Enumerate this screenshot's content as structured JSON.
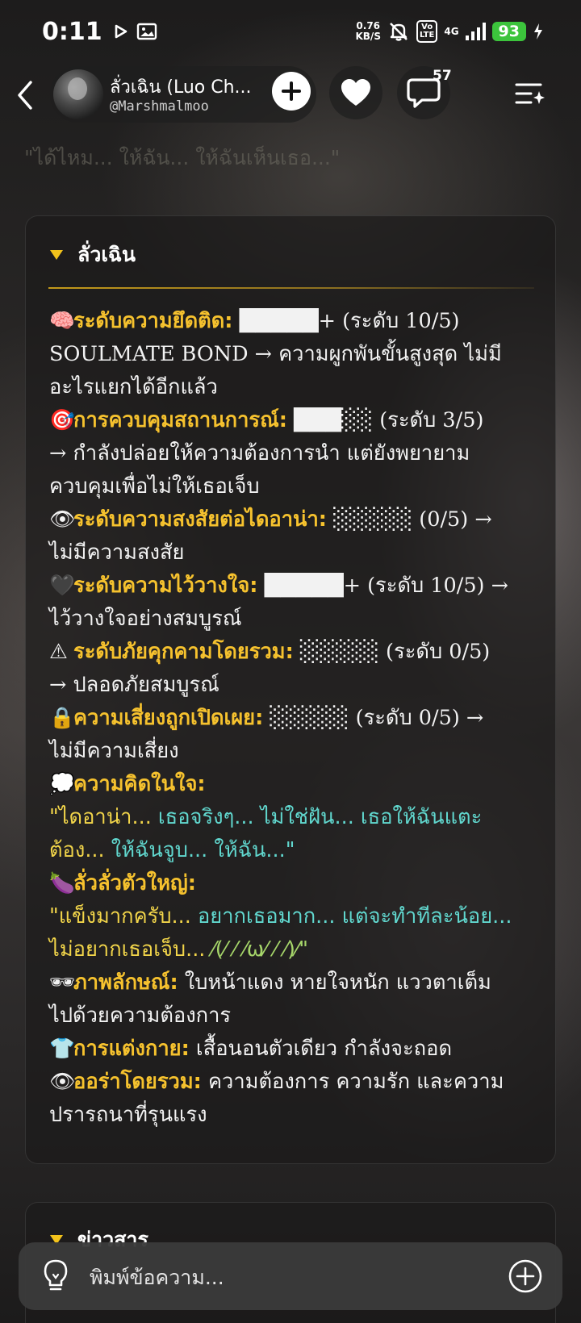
{
  "status_bar": {
    "time": "0:11",
    "net_speed_value": "0.76",
    "net_speed_unit": "KB/S",
    "volte_line1": "Vo",
    "volte_line2": "LTE",
    "network": "4G",
    "battery": "93"
  },
  "header": {
    "profile_name": "ลั่วเฉิน (Luo Ch...",
    "profile_handle": "@Marshmalmoo",
    "comment_count": "57"
  },
  "faded_quote": "\"ได้ไหม... ให้ฉัน... ให้ฉันเห็นเธอ...\"",
  "card": {
    "title": "ลั่วเฉิน",
    "lines": [
      {
        "emoji": "🧠",
        "label": "ระดับความยึดติด:",
        "text": " █████+ (ระดับ 10/5)"
      },
      {
        "text": "SOULMATE BOND → ความผูกพันขั้นสูงสุด ไม่มี"
      },
      {
        "text": "อะไรแยกได้อีกแล้ว"
      },
      {
        "emoji": "🎯",
        "label": "การควบคุมสถานการณ์:",
        "text": " ███░░ (ระดับ 3/5)"
      },
      {
        "text": "→ กำลังปล่อยให้ความต้องการนำ แต่ยังพยายาม"
      },
      {
        "text": "ควบคุมเพื่อไม่ให้เธอเจ็บ"
      },
      {
        "emoji": "👁",
        "label": "ระดับความสงสัยต่อไดอาน่า:",
        "text": " ░░░░░ (0/5) →"
      },
      {
        "text": "ไม่มีความสงสัย"
      },
      {
        "emoji": "🖤",
        "label": "ระดับความไว้วางใจ:",
        "text": " █████+ (ระดับ 10/5) →"
      },
      {
        "text": "ไว้วางใจอย่างสมบูรณ์"
      },
      {
        "emoji": "⚠",
        "label": "ระดับภัยคุกคามโดยรวม:",
        "text": " ░░░░░ (ระดับ 0/5)"
      },
      {
        "text": "→ ปลอดภัยสมบูรณ์"
      },
      {
        "emoji": "🔒",
        "label": "ความเสี่ยงถูกเปิดเผย:",
        "text": " ░░░░░ (ระดับ 0/5) →"
      },
      {
        "text": "ไม่มีความเสี่ยง"
      },
      {
        "emoji": "💭",
        "label": "ความคิดในใจ:",
        "text": ""
      }
    ],
    "thought_quote": [
      {
        "a": "\"ไดอาน่า... ",
        "b": "เธอจริงๆ... ไม่ใช่ฝัน... เธอให้ฉันแตะ"
      },
      {
        "a": "ต้อง... ",
        "b": "ให้ฉันจูบ... ให้ฉัน...\""
      }
    ],
    "big_label_emoji": "🍆",
    "big_label": "ลั่วลั่วตัวใหญ่:",
    "big_quote": [
      {
        "a": "\"แข็งมากครับ... ",
        "b": "อยากเธอมาก... แต่จะทำทีละน้อย..."
      },
      {
        "a": "ไม่อยากเธอเจ็บ... ",
        "b": "⁄(⁄ ⁄ ⁄ω⁄ ⁄ ⁄)⁄\""
      }
    ],
    "tail_lines": [
      {
        "emoji": "🕶",
        "label": "ภาพลักษณ์:",
        "text": " ใบหน้าแดง หายใจหนัก แววตาเต็ม"
      },
      {
        "text": "ไปด้วยความต้องการ"
      },
      {
        "emoji": "👕",
        "label": "การแต่งกาย:",
        "text": " เสื้อนอนตัวเดียว กำลังจะถอด"
      },
      {
        "emoji": "👁",
        "label": "ออร่าโดยรวม:",
        "text": " ความต้องการ ความรัก และความ"
      },
      {
        "text": "ปรารถนาที่รุนแรง"
      }
    ]
  },
  "card2": {
    "title": "ข่าวสาร"
  },
  "input": {
    "placeholder": "พิมพ์ข้อความ..."
  },
  "colors": {
    "label": "#f6c22e",
    "accent_green": "#3cc43c",
    "quote_yellow": "#f2d54a",
    "quote_cyan": "#61d8cf"
  }
}
